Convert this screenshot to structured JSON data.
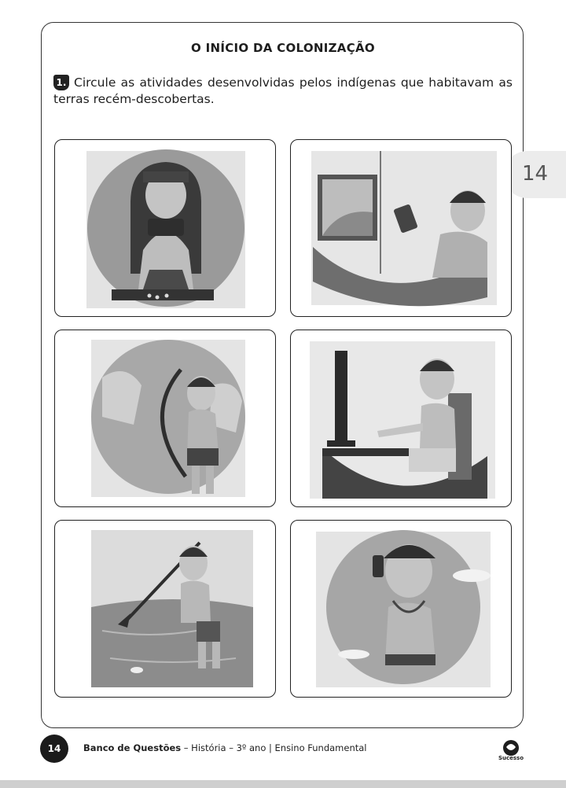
{
  "title": "O INÍCIO DA COLONIZAÇÃO",
  "question": {
    "number": "1.",
    "text": "Circule as atividades desenvolvidas pelos indígenas que habitavam as terras recém-descobertas."
  },
  "side_tab": "14",
  "footer": {
    "page_number": "14",
    "book": "Banco de Questões",
    "rest": " – História – 3º ano | Ensino Fundamental",
    "logo": "Sucesso"
  },
  "colors": {
    "frame": "#333333",
    "tab": "#ececec",
    "badge": "#1b1b1b"
  }
}
